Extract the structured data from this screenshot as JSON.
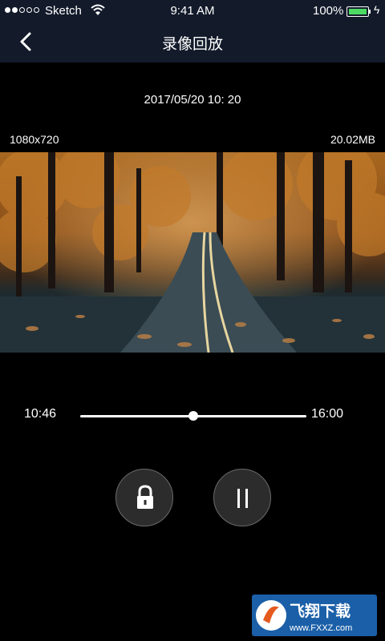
{
  "status_bar": {
    "carrier": "Sketch",
    "time": "9:41 AM",
    "battery": "100%",
    "signal_bars_filled": 2,
    "signal_bars_total": 5
  },
  "nav": {
    "back_icon": "chevron-left-icon",
    "title": "录像回放"
  },
  "recording": {
    "datetime": "2017/05/20 10: 20",
    "resolution": "1080x720",
    "file_size": "20.02MB"
  },
  "playback": {
    "start_time": "10:46",
    "end_time": "16:00",
    "progress": 0.5
  },
  "controls": {
    "lock_icon": "lock-icon",
    "pause_icon": "pause-icon"
  },
  "watermark": {
    "title": "飞翔下载",
    "url": "www.FXXZ.com"
  },
  "colors": {
    "header_bg": "#131b2a",
    "background": "#000000",
    "battery_fill": "#4cd964",
    "control_bg": "#2c2c2c",
    "watermark_bg": "#1a5fa8"
  }
}
